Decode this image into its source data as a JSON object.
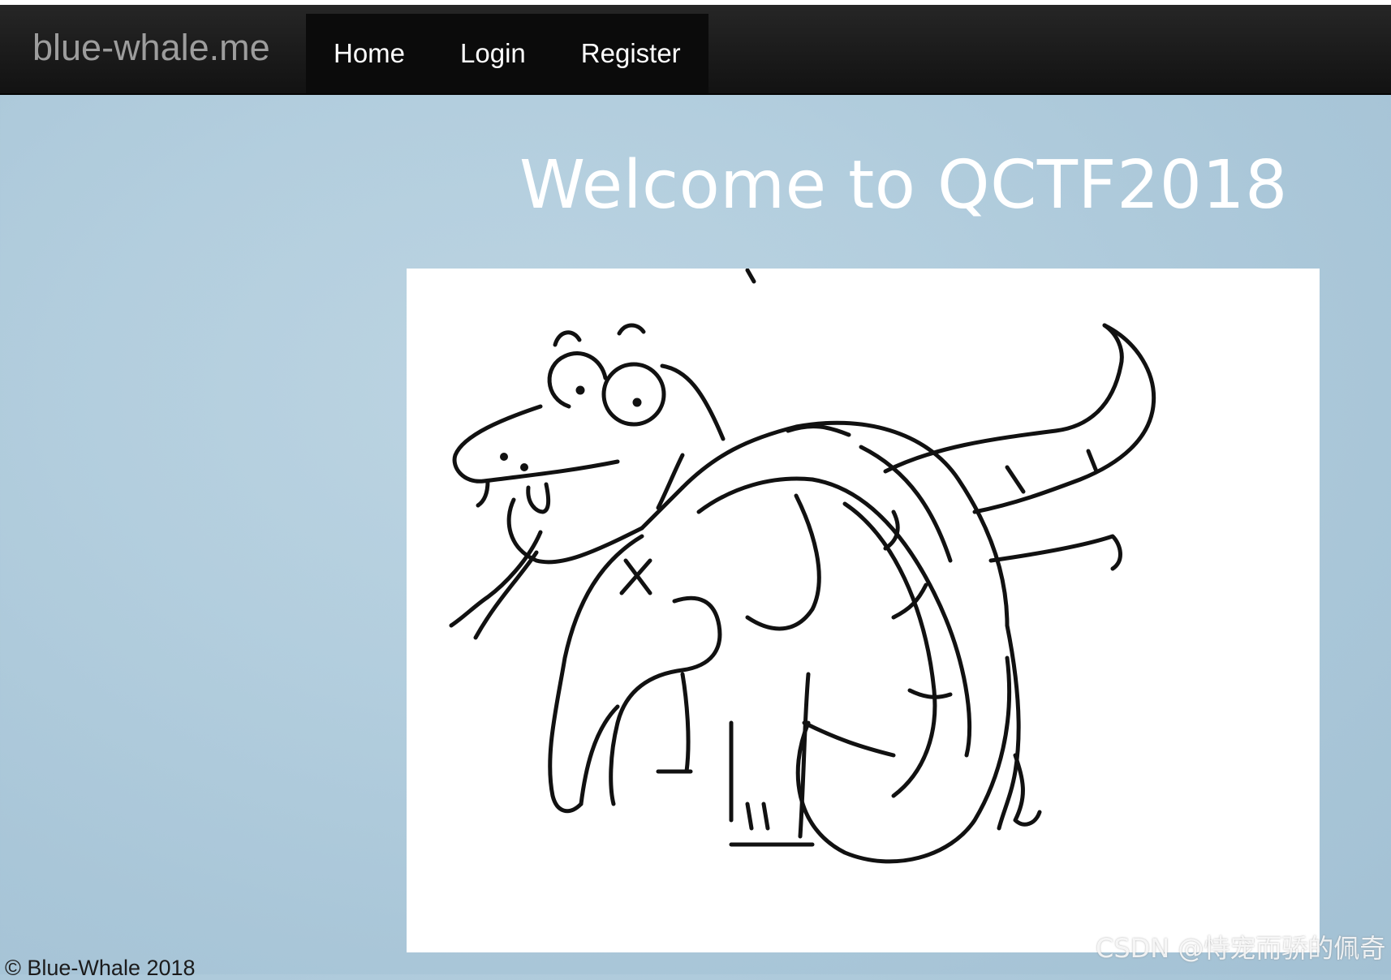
{
  "navbar": {
    "brand": "blue-whale.me",
    "items": [
      {
        "label": "Home"
      },
      {
        "label": "Login"
      },
      {
        "label": "Register"
      }
    ]
  },
  "main": {
    "heading": "Welcome to QCTF2018",
    "image_alt": "sketch of a snake coiled around an elephant"
  },
  "footer": {
    "copyright": "© Blue-Whale 2018"
  },
  "watermark": "CSDN @恃宠而骄的佩奇",
  "colors": {
    "navbar_bg": "#1a1a1a",
    "nav_active_bg": "#0b0b0b",
    "brand_text": "#9d9d9d",
    "page_bg": "#b3cede",
    "heading_text": "#ffffff"
  }
}
